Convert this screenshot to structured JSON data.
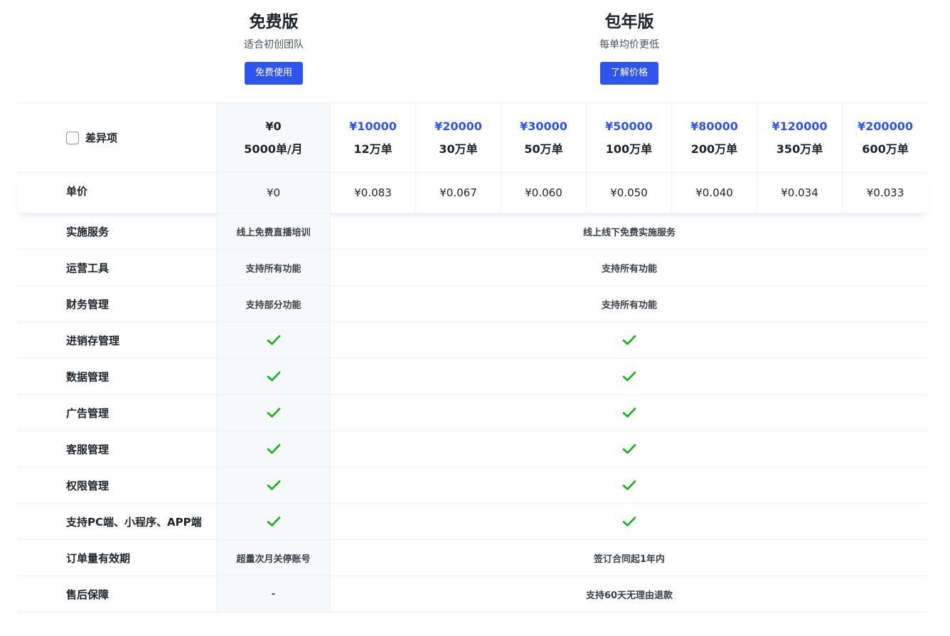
{
  "plans": {
    "free": {
      "title": "免费版",
      "subtitle": "适合初创团队",
      "button": "免费使用"
    },
    "annual": {
      "title": "包年版",
      "subtitle": "每单均价更低",
      "button": "了解价格"
    }
  },
  "table": {
    "diff_label": "差异项",
    "unit_price_label": "单价",
    "tiers": [
      {
        "price": "¥0",
        "orders": "5000单/月",
        "unit": "¥0"
      },
      {
        "price": "¥10000",
        "orders": "12万单",
        "unit": "¥0.083"
      },
      {
        "price": "¥20000",
        "orders": "30万单",
        "unit": "¥0.067"
      },
      {
        "price": "¥30000",
        "orders": "50万单",
        "unit": "¥0.060"
      },
      {
        "price": "¥50000",
        "orders": "100万单",
        "unit": "¥0.050"
      },
      {
        "price": "¥80000",
        "orders": "200万单",
        "unit": "¥0.040"
      },
      {
        "price": "¥120000",
        "orders": "350万单",
        "unit": "¥0.034"
      },
      {
        "price": "¥200000",
        "orders": "600万单",
        "unit": "¥0.033"
      }
    ],
    "features": [
      {
        "name": "实施服务",
        "free": "线上免费直播培训",
        "paid": "线上线下免费实施服务"
      },
      {
        "name": "运营工具",
        "free": "支持所有功能",
        "paid": "支持所有功能"
      },
      {
        "name": "财务管理",
        "free": "支持部分功能",
        "paid": "支持所有功能"
      },
      {
        "name": "进销存管理",
        "free": "check",
        "paid": "check"
      },
      {
        "name": "数据管理",
        "free": "check",
        "paid": "check"
      },
      {
        "name": "广告管理",
        "free": "check",
        "paid": "check"
      },
      {
        "name": "客服管理",
        "free": "check",
        "paid": "check"
      },
      {
        "name": "权限管理",
        "free": "check",
        "paid": "check"
      },
      {
        "name": "支持PC端、小程序、APP端",
        "free": "check",
        "paid": "check"
      },
      {
        "name": "订单量有效期",
        "free": "超量次月关停账号",
        "paid": "签订合同起1年内"
      },
      {
        "name": "售后保障",
        "free": "-",
        "paid": "支持60天无理由退款"
      }
    ]
  },
  "colors": {
    "accent": "#2f54eb",
    "check": "#15b01a",
    "free_column_bg": "#f7f8fc"
  }
}
